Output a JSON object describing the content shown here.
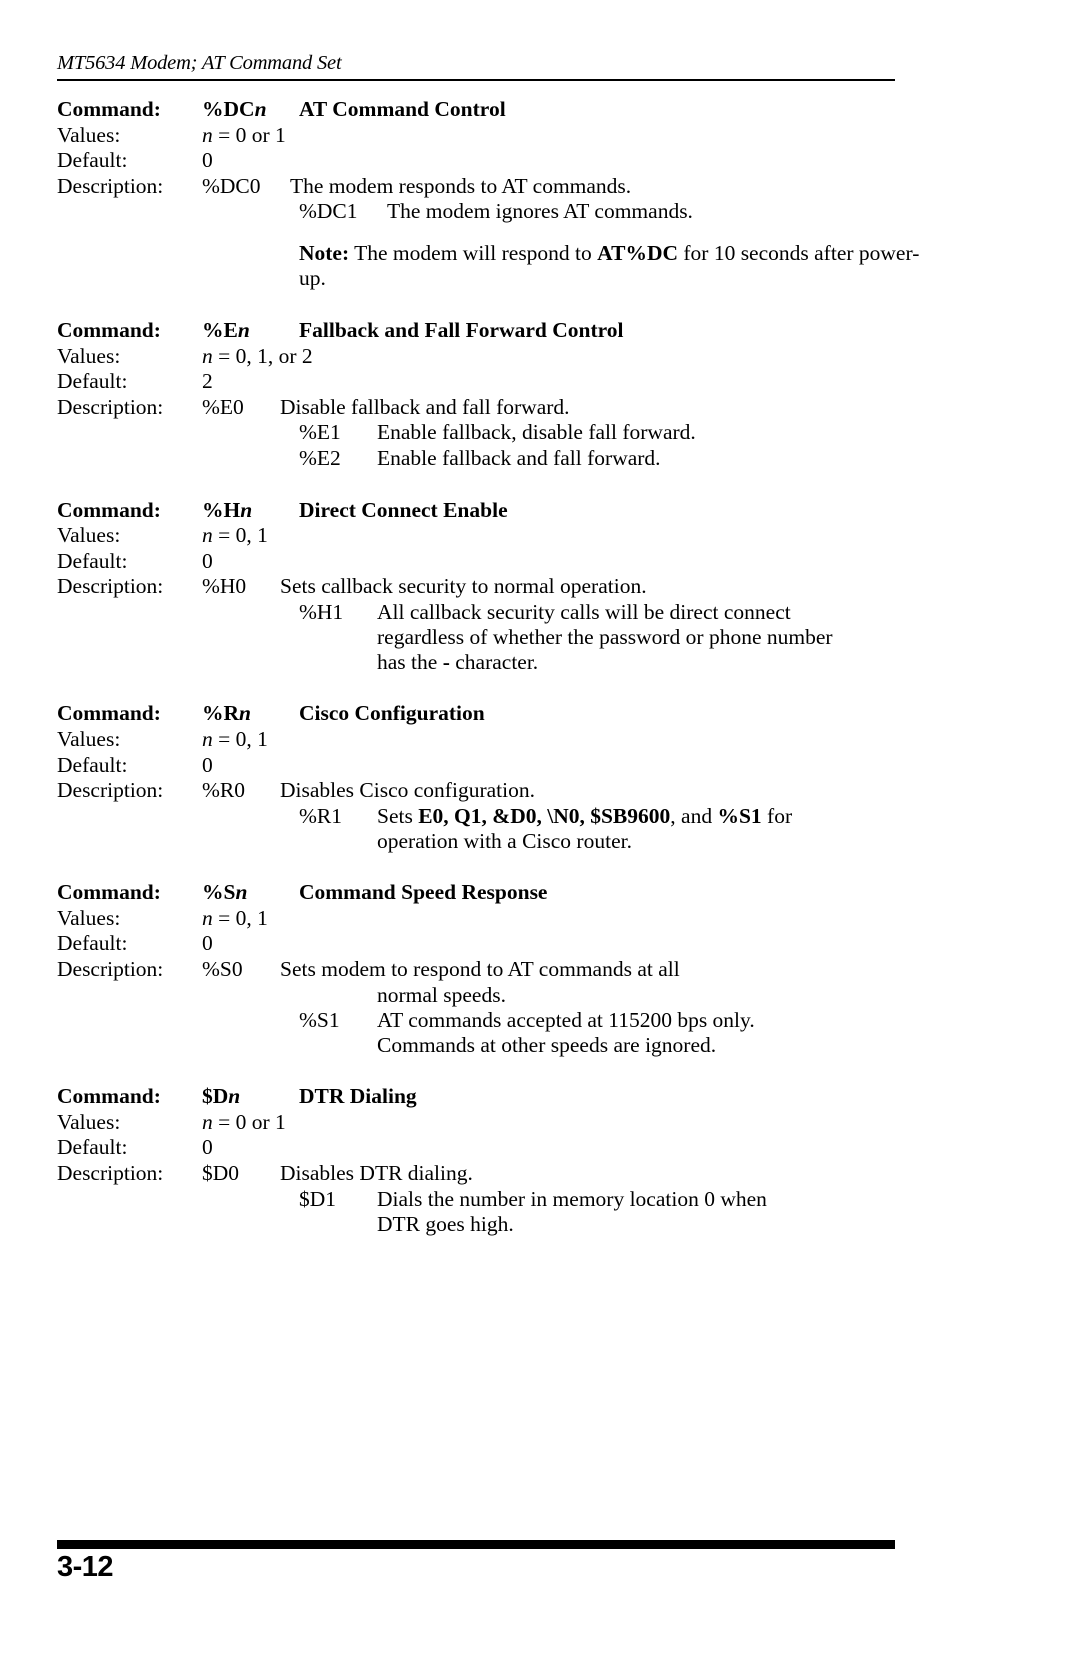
{
  "header": {
    "running_head": "MT5634 Modem; AT Command Set"
  },
  "labels": {
    "command": "Command:",
    "values": "Values:",
    "default": "Default:",
    "description": "Description:"
  },
  "commands": [
    {
      "syntax_base": "%DC",
      "syntax_var": "n",
      "title": "AT Command Control",
      "values": "n = 0 or 1",
      "values_var": "n",
      "values_rest": " = 0 or 1",
      "default": "0",
      "descriptions": [
        {
          "code": "%DC0",
          "text": "The modem responds to AT commands."
        },
        {
          "code": "%DC1",
          "text": "The modem ignores AT commands."
        }
      ],
      "note": {
        "label": "Note:",
        "text_before": " The modem will respond to ",
        "bold_term": "AT%DC",
        "text_after": " for 10 seconds after power-up."
      }
    },
    {
      "syntax_base": "%E",
      "syntax_var": "n",
      "title": "Fallback and Fall Forward Control",
      "values_var": "n",
      "values_rest": " = 0, 1, or 2",
      "default": "2",
      "descriptions": [
        {
          "code": "%E0",
          "text": "Disable fallback and fall forward."
        },
        {
          "code": "%E1",
          "text": "Enable fallback, disable fall forward."
        },
        {
          "code": "%E2",
          "text": "Enable fallback and fall forward."
        }
      ]
    },
    {
      "syntax_base": "%H",
      "syntax_var": "n",
      "title": "Direct Connect Enable",
      "values_var": "n",
      "values_rest": " = 0, 1",
      "default": "0",
      "descriptions": [
        {
          "code": "%H0",
          "text": "Sets callback security to normal operation."
        },
        {
          "code": "%H1",
          "text": "All callback security calls will be direct connect"
        }
      ],
      "continuation": [
        "regardless of whether the password or phone number",
        "has the - character."
      ],
      "continuation_bold_char": "-",
      "cont_line2_before": "has the ",
      "cont_line2_after": " character."
    },
    {
      "syntax_base": "%R",
      "syntax_var": "n",
      "title": "Cisco Configuration",
      "values_var": "n",
      "values_rest": " = 0, 1",
      "default": "0",
      "descriptions": [
        {
          "code": "%R0",
          "text": "Disables Cisco configuration."
        }
      ],
      "r1": {
        "code": "%R1",
        "before": "Sets ",
        "bold_list": "E0, Q1, &D0, \\N0, $SB9600",
        "middle": ", and ",
        "bold_term2": "%S1",
        "after": " for",
        "line2": "operation with a Cisco router."
      }
    },
    {
      "syntax_base": "%S",
      "syntax_var": "n",
      "title": "Command Speed Response",
      "values_var": "n",
      "values_rest": " = 0, 1",
      "default": "0",
      "descriptions": [
        {
          "code": "%S0",
          "text": "Sets modem to respond to AT commands at all"
        },
        {
          "code": "%S1",
          "text": "AT commands accepted at 115200 bps only."
        }
      ],
      "cont_after_s0": "normal speeds.",
      "cont_after_s1": "Commands at other speeds are ignored."
    },
    {
      "syntax_base": "$D",
      "syntax_var": "n",
      "title": "DTR Dialing",
      "values_var": "n",
      "values_rest": " = 0 or 1",
      "default": "0",
      "descriptions": [
        {
          "code": "$D0",
          "text": "Disables DTR dialing."
        },
        {
          "code": "$D1",
          "text": "Dials the number in memory location 0 when"
        }
      ],
      "cont_after_d1": "DTR goes high."
    }
  ],
  "footer": {
    "page_number": "3-12"
  }
}
